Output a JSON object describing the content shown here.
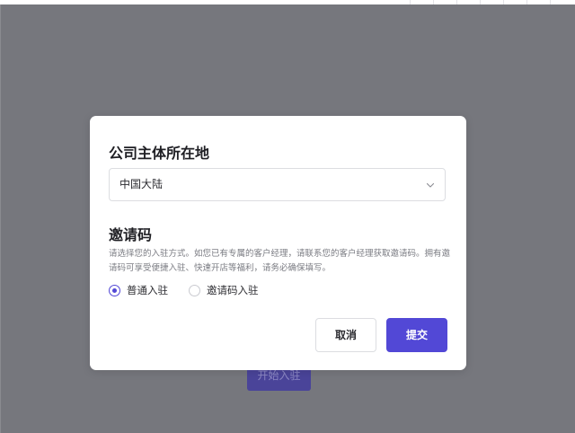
{
  "background": {
    "start_button_label": "开始入驻"
  },
  "modal": {
    "location_title": "公司主体所在地",
    "location_select": {
      "value": "中国大陆",
      "icon": "chevron-down-icon"
    },
    "invite_title": "邀请码",
    "invite_description": "请选择您的入驻方式。如您已有专属的客户经理，请联系您的客户经理获取邀请码。拥有邀请码可享受便捷入驻、快速开店等福利，请务必确保填写。",
    "radio_options": [
      {
        "label": "普通入驻",
        "checked": true
      },
      {
        "label": "邀请码入驻",
        "checked": false
      }
    ],
    "cancel_label": "取消",
    "submit_label": "提交"
  },
  "colors": {
    "accent": "#5248d6",
    "overlay": "#76777d"
  }
}
